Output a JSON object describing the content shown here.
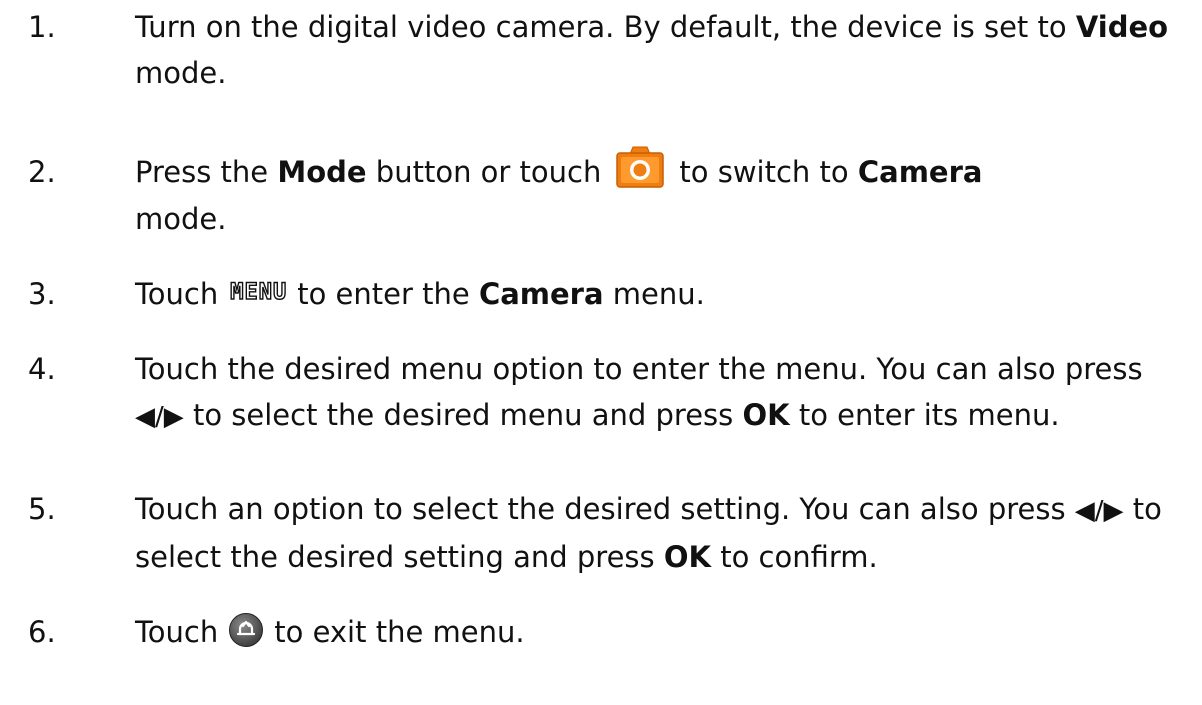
{
  "steps": [
    {
      "number": "1.",
      "parts": [
        "Turn on the digital video camera. By default, the device is set to ",
        "Video",
        " mode."
      ]
    },
    {
      "number": "2.",
      "parts": [
        "Press the ",
        "Mode",
        " button or touch",
        "to switch to ",
        "Camera",
        " mode."
      ],
      "icon": "camera-mode-icon"
    },
    {
      "number": "3.",
      "parts": [
        "Touch",
        "MENU",
        "to enter the ",
        "Camera",
        " menu."
      ],
      "icon": "menu-icon"
    },
    {
      "number": "4.",
      "parts": [
        "Touch the desired menu option to enter the menu. You can also press ",
        "◀/▶",
        " to select the desired menu and press ",
        "OK",
        " to enter its menu."
      ]
    },
    {
      "number": "5.",
      "parts": [
        "Touch an option to select the desired setting. You can also press ",
        "◀/▶",
        " to select the desired setting and press ",
        "OK",
        " to confirm."
      ]
    },
    {
      "number": "6.",
      "parts": [
        "Touch",
        "to exit the menu."
      ],
      "icon": "back-icon"
    }
  ],
  "colors": {
    "camera_icon_orange": "#f07d10",
    "back_icon_gray": "#5a5a5a"
  }
}
